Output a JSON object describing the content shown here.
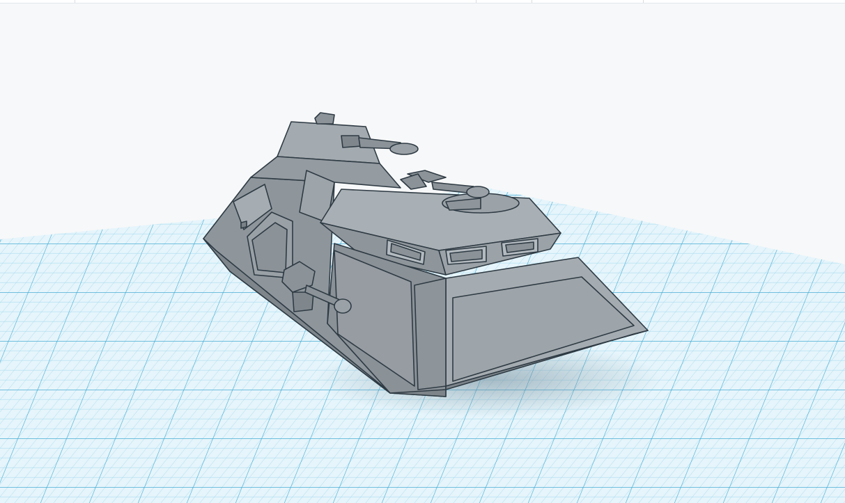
{
  "app": {
    "workspace": {
      "background_color": "#f7f8f9",
      "grid_color": "#3fa9d3",
      "grid_fill_color": "#e6f5fb"
    },
    "model": {
      "icon": "armored-vehicle-model",
      "color": "#9aa2a8"
    }
  }
}
